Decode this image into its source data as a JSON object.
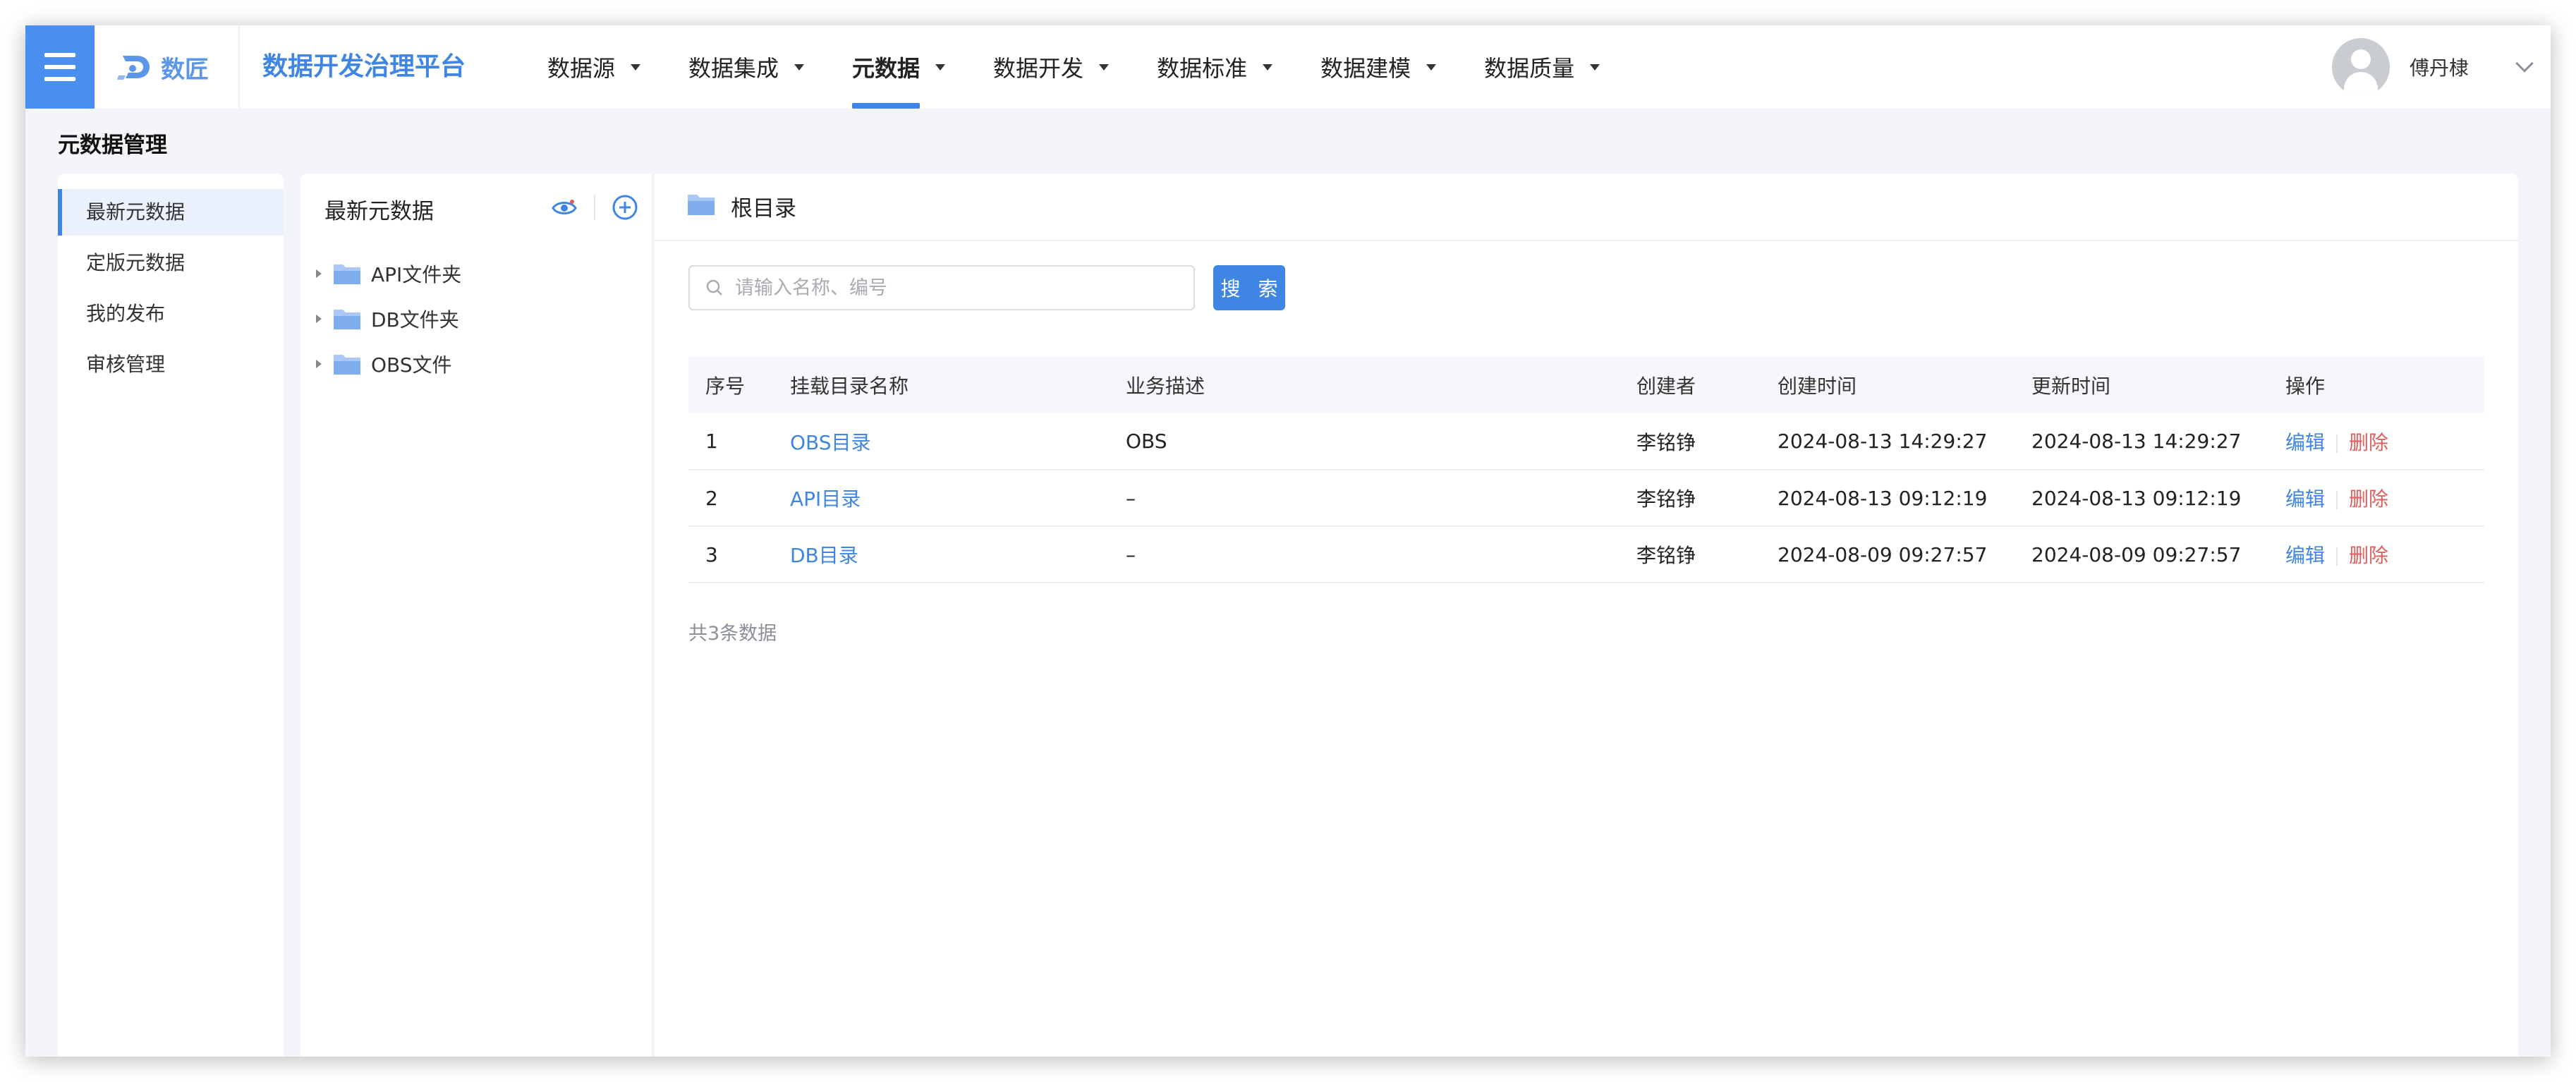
{
  "header": {
    "logo_text": "数匠",
    "platform_title": "数据开发治理平台",
    "nav": [
      {
        "label": "数据源",
        "active": false
      },
      {
        "label": "数据集成",
        "active": false
      },
      {
        "label": "元数据",
        "active": true
      },
      {
        "label": "数据开发",
        "active": false
      },
      {
        "label": "数据标准",
        "active": false
      },
      {
        "label": "数据建模",
        "active": false
      },
      {
        "label": "数据质量",
        "active": false
      }
    ],
    "username": "傅丹棣"
  },
  "page_title": "元数据管理",
  "sidebar": {
    "items": [
      {
        "label": "最新元数据",
        "active": true
      },
      {
        "label": "定版元数据",
        "active": false
      },
      {
        "label": "我的发布",
        "active": false
      },
      {
        "label": "审核管理",
        "active": false
      }
    ]
  },
  "tree": {
    "title": "最新元数据",
    "nodes": [
      {
        "label": "API文件夹"
      },
      {
        "label": "DB文件夹"
      },
      {
        "label": "OBS文件"
      }
    ]
  },
  "main": {
    "breadcrumb": "根目录",
    "search": {
      "placeholder": "请输入名称、编号",
      "value": "",
      "button_label": "搜 索"
    },
    "table": {
      "columns": [
        "序号",
        "挂载目录名称",
        "业务描述",
        "创建者",
        "创建时间",
        "更新时间",
        "操作"
      ],
      "rows": [
        {
          "index": "1",
          "name": "OBS目录",
          "desc": "OBS",
          "creator": "李铭铮",
          "created": "2024-08-13 14:29:27",
          "updated": "2024-08-13 14:29:27"
        },
        {
          "index": "2",
          "name": "API目录",
          "desc": "–",
          "creator": "李铭铮",
          "created": "2024-08-13 09:12:19",
          "updated": "2024-08-13 09:12:19"
        },
        {
          "index": "3",
          "name": "DB目录",
          "desc": "–",
          "creator": "李铭铮",
          "created": "2024-08-09 09:27:57",
          "updated": "2024-08-09 09:27:57"
        }
      ],
      "edit_label": "编辑",
      "delete_label": "删除"
    },
    "total_text": "共3条数据"
  },
  "colors": {
    "accent": "#3f85e4",
    "menu_button": "#4a8ff0",
    "delete": "#e25c5c",
    "folder": "#a9c8f5"
  },
  "icons": [
    "menu-icon",
    "logo-icon",
    "caret-down-icon",
    "avatar-icon",
    "chevron-down-icon",
    "eye-icon",
    "plus-circle-icon",
    "folder-icon",
    "search-icon"
  ]
}
